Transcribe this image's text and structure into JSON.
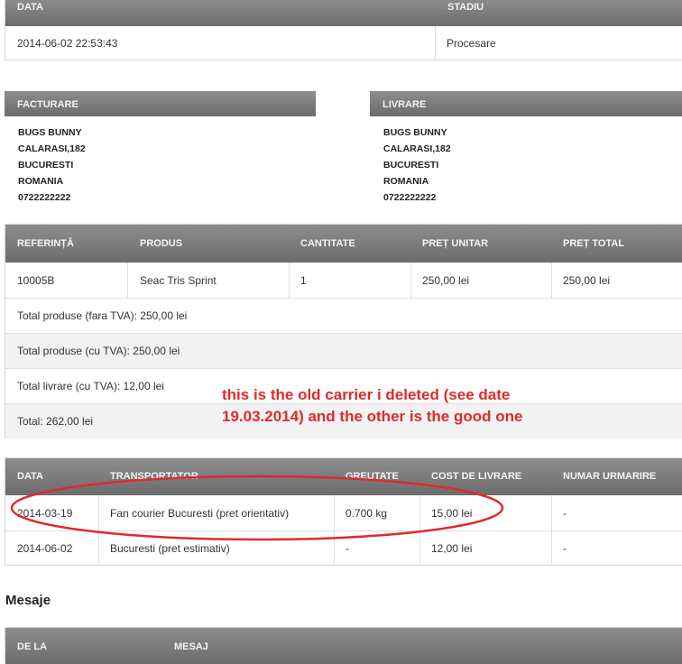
{
  "status_table": {
    "headers": [
      "DATA",
      "STADIU"
    ],
    "row": [
      "2014-06-02 22:53:43",
      "Procesare"
    ]
  },
  "billing": {
    "title": "FACTURARE",
    "lines": [
      "BUGS BUNNY",
      "CALARASI,182",
      "BUCURESTI",
      "ROMANIA",
      "0722222222"
    ]
  },
  "delivery": {
    "title": "LIVRARE",
    "lines": [
      "BUGS BUNNY",
      "CALARASI,182",
      "BUCURESTI",
      "ROMANIA",
      "0722222222"
    ]
  },
  "products_table": {
    "headers": [
      "REFERINȚĂ",
      "PRODUS",
      "CANTITATE",
      "PREȚ UNITAR",
      "PREȚ TOTAL"
    ],
    "row": [
      "10005B",
      "Seac Tris Sprint",
      "1",
      "250,00 lei",
      "250,00 lei"
    ],
    "totals": [
      "Total produse (fara TVA): 250,00 lei",
      "Total produse (cu TVA): 250,00 lei",
      "Total livrare (cu TVA): 12,00 lei",
      "Total: 262,00 lei"
    ]
  },
  "annotation": {
    "text": "this is the old carrier i deleted (see date 19.03.2014) and the other is the good one",
    "color": "#e02a2a"
  },
  "carriers_table": {
    "headers": [
      "DATA",
      "TRANSPORTATOR",
      "GREUTATE",
      "COST DE LIVRARE",
      "NUMAR URMARIRE"
    ],
    "rows": [
      [
        "2014-03-19",
        "Fan courier Bucuresti (pret orientativ)",
        "0.700 kg",
        "15,00 lei",
        "-"
      ],
      [
        "2014-06-02",
        "Bucuresti (pret estimativ)",
        "-",
        "12,00 lei",
        "-"
      ]
    ]
  },
  "messages": {
    "title": "Mesaje",
    "headers": [
      "DE LA",
      "MESAJ"
    ]
  }
}
